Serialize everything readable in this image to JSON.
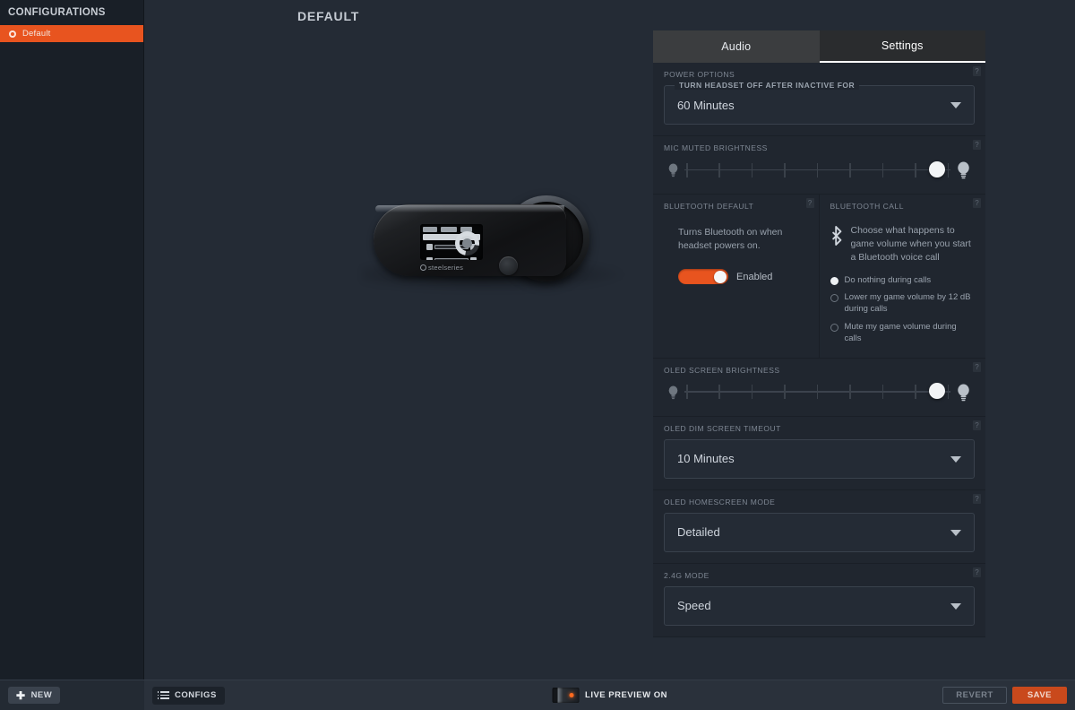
{
  "sidebar": {
    "header": "CONFIGURATIONS",
    "items": [
      {
        "label": "Default",
        "active": true
      }
    ],
    "new_button": "NEW"
  },
  "page": {
    "title": "DEFAULT"
  },
  "tabs": [
    {
      "label": "Audio",
      "active": false
    },
    {
      "label": "Settings",
      "active": true
    }
  ],
  "sections": {
    "power_options": {
      "title": "POWER OPTIONS",
      "help": "?",
      "field_label": "TURN HEADSET OFF AFTER INACTIVE FOR",
      "value": "60 Minutes"
    },
    "mic_muted_brightness": {
      "title": "MIC MUTED BRIGHTNESS",
      "help": "?",
      "value_percent": 100,
      "tick_count": 9,
      "icon_low": "bulb-dim-icon",
      "icon_high": "bulb-bright-icon"
    },
    "bluetooth_default": {
      "title": "BLUETOOTH DEFAULT",
      "help": "?",
      "description": "Turns Bluetooth on when headset powers on.",
      "toggle_state": "on",
      "toggle_label": "Enabled",
      "accent": "#e8541f"
    },
    "bluetooth_call": {
      "title": "BLUETOOTH CALL",
      "help": "?",
      "icon": "bluetooth-icon",
      "description": "Choose what happens to game volume when you start a Bluetooth voice call",
      "options": [
        {
          "label": "Do nothing during calls",
          "selected": true
        },
        {
          "label": "Lower my game volume by 12 dB during calls",
          "selected": false
        },
        {
          "label": "Mute my game volume during calls",
          "selected": false
        }
      ]
    },
    "oled_screen_brightness": {
      "title": "OLED SCREEN BRIGHTNESS",
      "help": "?",
      "value_percent": 100,
      "tick_count": 9,
      "icon_low": "bulb-dim-icon",
      "icon_high": "bulb-bright-icon"
    },
    "oled_dim_screen_timeout": {
      "title": "OLED DIM SCREEN TIMEOUT",
      "help": "?",
      "value": "10 Minutes"
    },
    "oled_homescreen_mode": {
      "title": "OLED HOMESCREEN MODE",
      "help": "?",
      "value": "Detailed"
    },
    "mode_24g": {
      "title": "2.4G MODE",
      "help": "?",
      "value": "Speed"
    }
  },
  "product": {
    "brand": "steelseries"
  },
  "bottom_bar": {
    "configs_button": "CONFIGS",
    "live_preview": "LIVE PREVIEW ON",
    "revert_button": "REVERT",
    "save_button": "SAVE"
  }
}
